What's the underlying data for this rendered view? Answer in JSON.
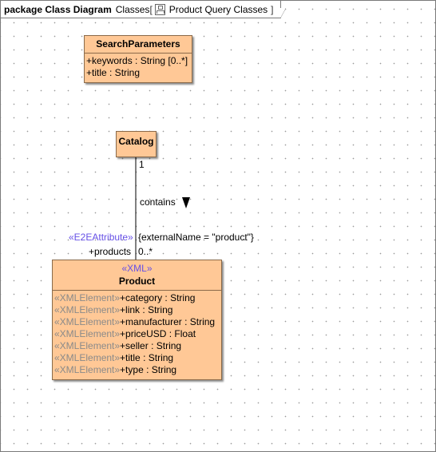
{
  "frame": {
    "keyword": "package Class Diagram",
    "path": "Classes",
    "bracket_open": "[",
    "diagram_name": "Product Query Classes",
    "bracket_close": "]"
  },
  "classes": {
    "search_parameters": {
      "name": "SearchParameters",
      "attributes": [
        {
          "text": "+keywords : String [0..*]"
        },
        {
          "text": "+title : String"
        }
      ]
    },
    "catalog": {
      "name": "Catalog"
    },
    "product": {
      "stereotype": "«XML»",
      "name": "Product",
      "attributes": [
        {
          "stereotype": "«XMLElement»",
          "text": "+category : String"
        },
        {
          "stereotype": "«XMLElement»",
          "text": "+link : String"
        },
        {
          "stereotype": "«XMLElement»",
          "text": "+manufacturer : String"
        },
        {
          "stereotype": "«XMLElement»",
          "text": "+priceUSD : Float"
        },
        {
          "stereotype": "«XMLElement»",
          "text": "+seller : String"
        },
        {
          "stereotype": "«XMLElement»",
          "text": "+title : String"
        },
        {
          "stereotype": "«XMLElement»",
          "text": "+type : String"
        }
      ]
    }
  },
  "association": {
    "name": "contains",
    "source_multiplicity": "1",
    "target_stereotype": "«E2EAttribute»",
    "tagged_value": "{externalName = \"product\"}",
    "target_role": "+products",
    "target_multiplicity": "0..*"
  },
  "colors": {
    "class_fill": "#ffc896",
    "stereotype": "#6650e6",
    "attribute_stereotype": "#8a8a8a"
  }
}
